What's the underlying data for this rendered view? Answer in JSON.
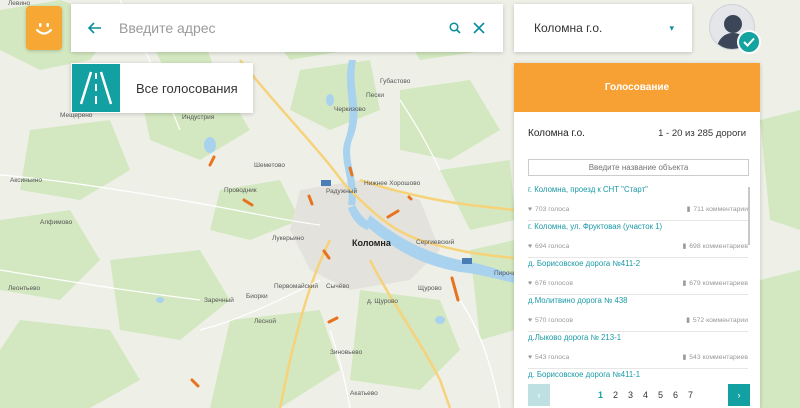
{
  "map": {
    "labels": {
      "levino": "Левино",
      "mashchenko": "Мещерено",
      "industriya": "Индустрия",
      "aksinyino": "Аксиньино",
      "alfimovo": "Алфимово",
      "leontyevo": "Леонтьево",
      "sheметovo": "Шеметово",
      "provodnik": "Проводник",
      "radushnyi": "Радужный",
      "nizhnee_khoroshovo": "Нижнее Хорошово",
      "lukerino": "Лукерьино",
      "kolomna": "Коломна",
      "sergievskiy": "Сергиевский",
      "pervomayskiy": "Первомайский",
      "sychevo": "Сычёво",
      "zarechny": "Заречный",
      "biorki": "Биорки",
      "lesnoy": "Лесной",
      "shchurovo_d": "д. Щурово",
      "shchurovo": "Щурово",
      "pirochi": "Пирочи",
      "zinovyevo": "Зиновьево",
      "akatyevo": "Акатьево",
      "gubastovo": "Губастово",
      "peski": "Пески",
      "cherkizovo": "Черкизово",
      "m5": "М-5"
    }
  },
  "search": {
    "placeholder": "Введите адрес"
  },
  "district_select": {
    "value": "Коломна г.о."
  },
  "all_votes": {
    "label": "Все голосования"
  },
  "panel": {
    "header": "Голосование",
    "district": "Коломна г.о.",
    "count": "1 - 20 из 285 дороги",
    "filter_placeholder": "Введите название объекта",
    "items": [
      {
        "title": "г. Коломна, проезд к СНТ \"Старт\"",
        "votes": "703 голоса",
        "comments": "711 комментарии"
      },
      {
        "title": "г. Коломна, ул. Фруктовая (участок 1)",
        "votes": "694 голоса",
        "comments": "698 комментариев"
      },
      {
        "title": "д. Борисовское дорога №411-2",
        "votes": "676 голосов",
        "comments": "679 комментариев"
      },
      {
        "title": "д.Молитвино дорога № 438",
        "votes": "570 голосов",
        "comments": "572 комментарии"
      },
      {
        "title": "д.Лыково дорога № 213-1",
        "votes": "543 голоса",
        "comments": "543 комментариев"
      },
      {
        "title": "д. Борисовское дорога №411-1",
        "votes": "",
        "comments": ""
      }
    ],
    "pages": [
      "1",
      "2",
      "3",
      "4",
      "5",
      "6",
      "7"
    ],
    "active_page": "1"
  },
  "colors": {
    "accent": "#12a0a3",
    "header": "#f7a033",
    "road_marker": "#e8731f"
  },
  "icons": {
    "back": "arrow-left-icon",
    "search": "search-icon",
    "clear": "close-icon",
    "chevron": "chevron-down-icon",
    "check": "check-icon",
    "road": "road-icon",
    "heart": "heart-icon",
    "comment": "comment-icon"
  }
}
